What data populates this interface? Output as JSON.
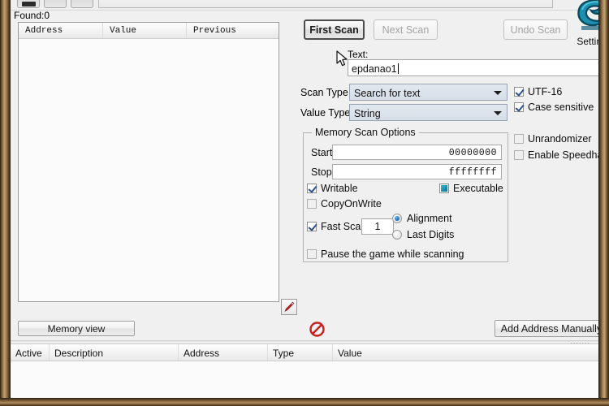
{
  "window": {
    "app": "Cheat Engine",
    "frame_color": "#8a6a40",
    "client_bg": "#f0f0f0"
  },
  "toolbar": {
    "buttons": [
      "toolbar-button-1",
      "toolbar-button-2",
      "toolbar-button-3"
    ],
    "field_value": ""
  },
  "status": {
    "found_label": "Found:0"
  },
  "results": {
    "columns": [
      "Address",
      "Value",
      "Previous"
    ],
    "rows": [],
    "arrow_button_icon": "red-arrow-icon"
  },
  "scan_buttons": {
    "first_scan": "First Scan",
    "next_scan": "Next Scan",
    "undo_scan": "Undo Scan",
    "first_scan_enabled": true,
    "next_scan_enabled": false,
    "undo_scan_enabled": false
  },
  "branding": {
    "logo_icon": "cheat-engine-logo",
    "logo_color": "#1d8fae",
    "settings_label": "Settings"
  },
  "search": {
    "text_label": "Text:",
    "text_value": "epdanao1",
    "placeholder": ""
  },
  "scan_type": {
    "label": "Scan Type",
    "value": "Search for text",
    "options": [
      "Search for text"
    ]
  },
  "value_type": {
    "label": "Value Type",
    "value": "String",
    "options": [
      "String"
    ]
  },
  "string_options": {
    "utf16": {
      "label": "UTF-16",
      "checked": true
    },
    "case_sensitive": {
      "label": "Case sensitive",
      "checked": true
    }
  },
  "side_options": {
    "unrandomizer": {
      "label": "Unrandomizer",
      "checked": false
    },
    "speedhack": {
      "label": "Enable Speedhack",
      "checked": false
    }
  },
  "memory_scan_options": {
    "title": "Memory Scan Options",
    "start_label": "Start",
    "start_value": "00000000",
    "stop_label": "Stop",
    "stop_value": "ffffffff",
    "writable": {
      "label": "Writable",
      "checked": true
    },
    "executable": {
      "label": "Executable",
      "state": "indeterminate"
    },
    "copyonwrite": {
      "label": "CopyOnWrite",
      "checked": false
    },
    "fast_scan": {
      "label": "Fast Scan",
      "checked": true,
      "value": "1"
    },
    "alignment": {
      "label": "Alignment",
      "selected": true
    },
    "last_digits": {
      "label": "Last Digits",
      "selected": false
    },
    "pause_game": {
      "label": "Pause the game while scanning",
      "checked": false
    }
  },
  "bottom_bar": {
    "memory_view": "Memory view",
    "add_address": "Add Address Manually",
    "stop_icon": "prohibition-icon",
    "grip": "......."
  },
  "cheat_table": {
    "columns": [
      "Active",
      "Description",
      "Address",
      "Type",
      "Value"
    ],
    "rows": []
  }
}
